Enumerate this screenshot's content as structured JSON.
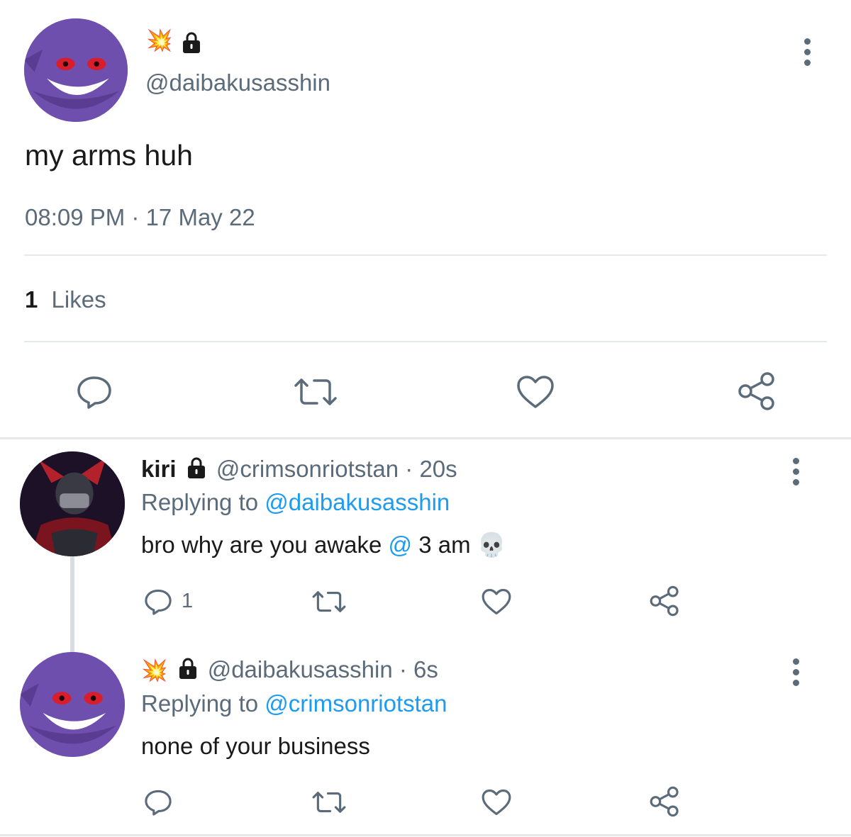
{
  "main_tweet": {
    "avatar": "gengar-avatar",
    "display_name_icons": [
      "collision-emoji",
      "lock-icon"
    ],
    "handle": "@daibakusasshin",
    "text": "my arms huh",
    "timestamp": "08:09 PM · 17 May 22",
    "likes_count": "1",
    "likes_label": "Likes"
  },
  "replies": [
    {
      "avatar": "kiri-avatar",
      "name": "kiri",
      "handle": "@crimsonriotstan",
      "time": "· 20s",
      "replying_prefix": "Replying to",
      "replying_to": "@daibakusasshin",
      "text_before": "bro why are you awake",
      "text_at": "@",
      "text_after": "3 am",
      "emoji": "💀",
      "reply_count": "1"
    },
    {
      "avatar": "gengar-avatar",
      "name_icons": [
        "collision-emoji",
        "lock-icon"
      ],
      "handle": "@daibakusasshin",
      "time": "· 6s",
      "replying_prefix": "Replying to",
      "replying_to": "@crimsonriotstan",
      "text": "none of your business",
      "reply_count": ""
    }
  ],
  "colors": {
    "muted": "#5b6b7a",
    "link": "#1d9bf0",
    "avatar_purple": "#6c4aa8"
  }
}
